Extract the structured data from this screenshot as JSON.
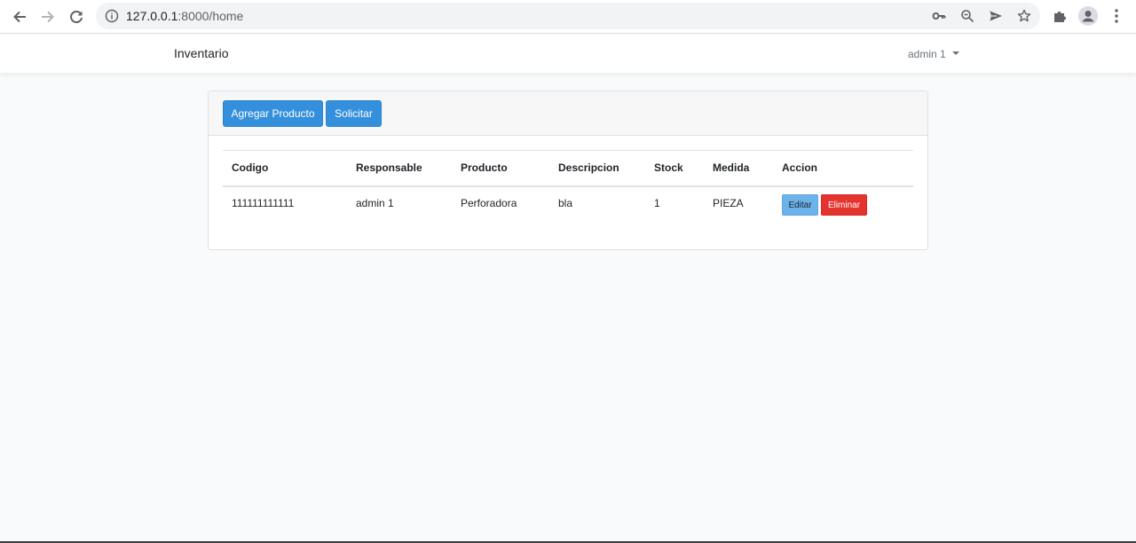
{
  "browser": {
    "url_host": "127.0.0.1",
    "url_rest": ":8000/home",
    "icons": [
      "back-icon",
      "forward-icon",
      "reload-icon",
      "info-icon",
      "key-icon",
      "zoom-icon",
      "send-icon",
      "star-icon",
      "extensions-icon",
      "profile-icon",
      "menu-icon"
    ]
  },
  "navbar": {
    "brand": "Inventario",
    "user": "admin 1"
  },
  "card": {
    "add_button": "Agregar Producto",
    "request_button": "Solicitar"
  },
  "table": {
    "headers": [
      "Codigo",
      "Responsable",
      "Producto",
      "Descripcion",
      "Stock",
      "Medida",
      "Accion"
    ],
    "rows": [
      {
        "codigo": "111111111111",
        "responsable": "admin 1",
        "producto": "Perforadora",
        "descripcion": "bla",
        "stock": "1",
        "medida": "PIEZA",
        "edit_label": "Editar",
        "delete_label": "Eliminar"
      }
    ]
  },
  "colors": {
    "primary": "#3490dc",
    "info": "#6cb2eb",
    "danger": "#e3342f",
    "page_bg": "#f8fafc"
  }
}
